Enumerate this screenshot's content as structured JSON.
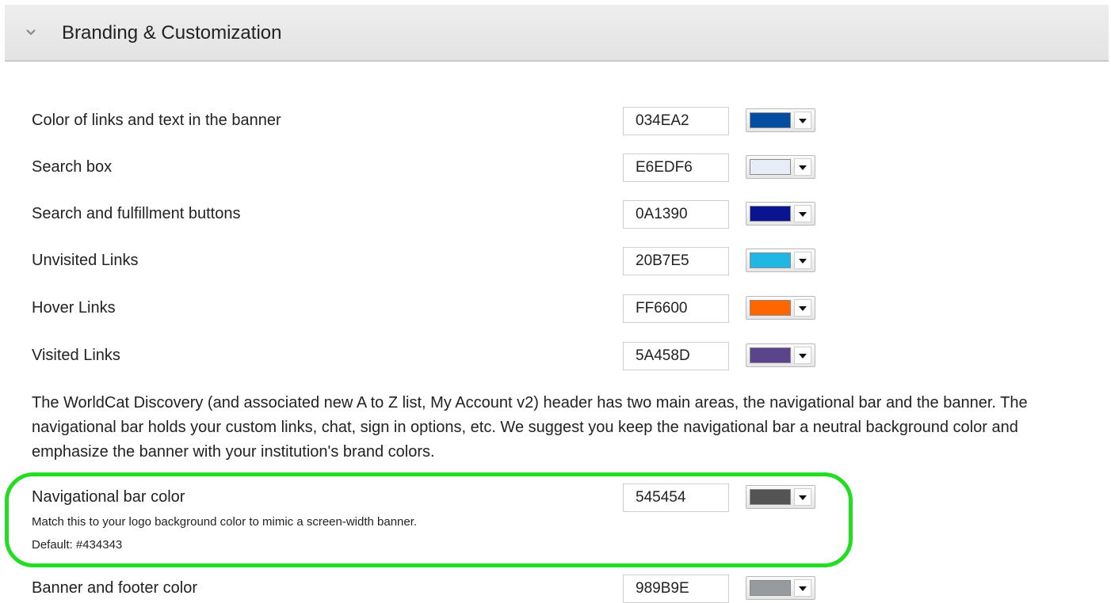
{
  "section": {
    "title": "Branding & Customization",
    "collapse_icon": "chevron-down-icon"
  },
  "color_rows": [
    {
      "label": "Color of links and text in the banner",
      "value": "034EA2",
      "swatch": "#034EA2"
    },
    {
      "label": "Search box",
      "value": "E6EDF6",
      "swatch": "#E6EDF6"
    },
    {
      "label": "Search and fulfillment buttons",
      "value": "0A1390",
      "swatch": "#0A1390"
    },
    {
      "label": "Unvisited Links",
      "value": "20B7E5",
      "swatch": "#20B7E5"
    },
    {
      "label": "Hover Links",
      "value": "FF6600",
      "swatch": "#FF6600"
    },
    {
      "label": "Visited Links",
      "value": "5A458D",
      "swatch": "#5A458D"
    }
  ],
  "description": "The WorldCat Discovery (and associated new A to Z list, My Account v2) header has two main areas, the navigational bar and the banner. The navigational bar holds your custom links, chat, sign in options, etc. We suggest you keep the navigational bar a neutral background color and emphasize the banner with your institution's brand colors.",
  "nav_bar": {
    "label": "Navigational bar color",
    "value": "545454",
    "swatch": "#545454",
    "help": "Match this to your logo background color to mimic a screen-width banner.",
    "default": "Default: #434343"
  },
  "banner_footer": {
    "label": "Banner and footer color",
    "value": "989B9E",
    "swatch": "#989B9E"
  },
  "colors": {
    "highlight": "#22DD22",
    "header_bg": "#E8E8E8"
  }
}
